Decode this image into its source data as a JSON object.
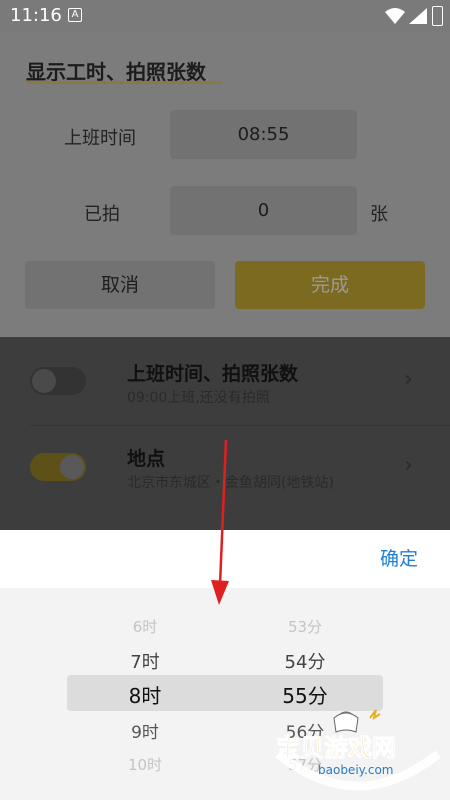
{
  "status": {
    "time": "11:16",
    "a_badge": "A"
  },
  "dialog": {
    "title": "显示工时、拍照张数",
    "work_time_label": "上班时间",
    "work_time_value": "08:55",
    "taken_label": "已拍",
    "taken_value": "0",
    "taken_unit": "张",
    "cancel_label": "取消",
    "done_label": "完成"
  },
  "list": {
    "items": [
      {
        "title": "上班时间、拍照张数",
        "subtitle": "09:00上班,还没有拍照",
        "enabled": false
      },
      {
        "title": "地点",
        "subtitle": "北京市东城区・金鱼胡同(地铁站)",
        "enabled": true
      }
    ]
  },
  "picker": {
    "confirm_label": "确定",
    "hours": [
      "6时",
      "7时",
      "8时",
      "9时",
      "10时"
    ],
    "minutes": [
      "53分",
      "54分",
      "55分",
      "56分",
      "57分"
    ],
    "selected_hour": "8时",
    "selected_minute": "55分"
  },
  "watermark": {
    "text": "宝贝游戏网",
    "url": "baobeiy.com"
  },
  "colors": {
    "accent": "#e8c53a",
    "link": "#1f7fd6"
  }
}
